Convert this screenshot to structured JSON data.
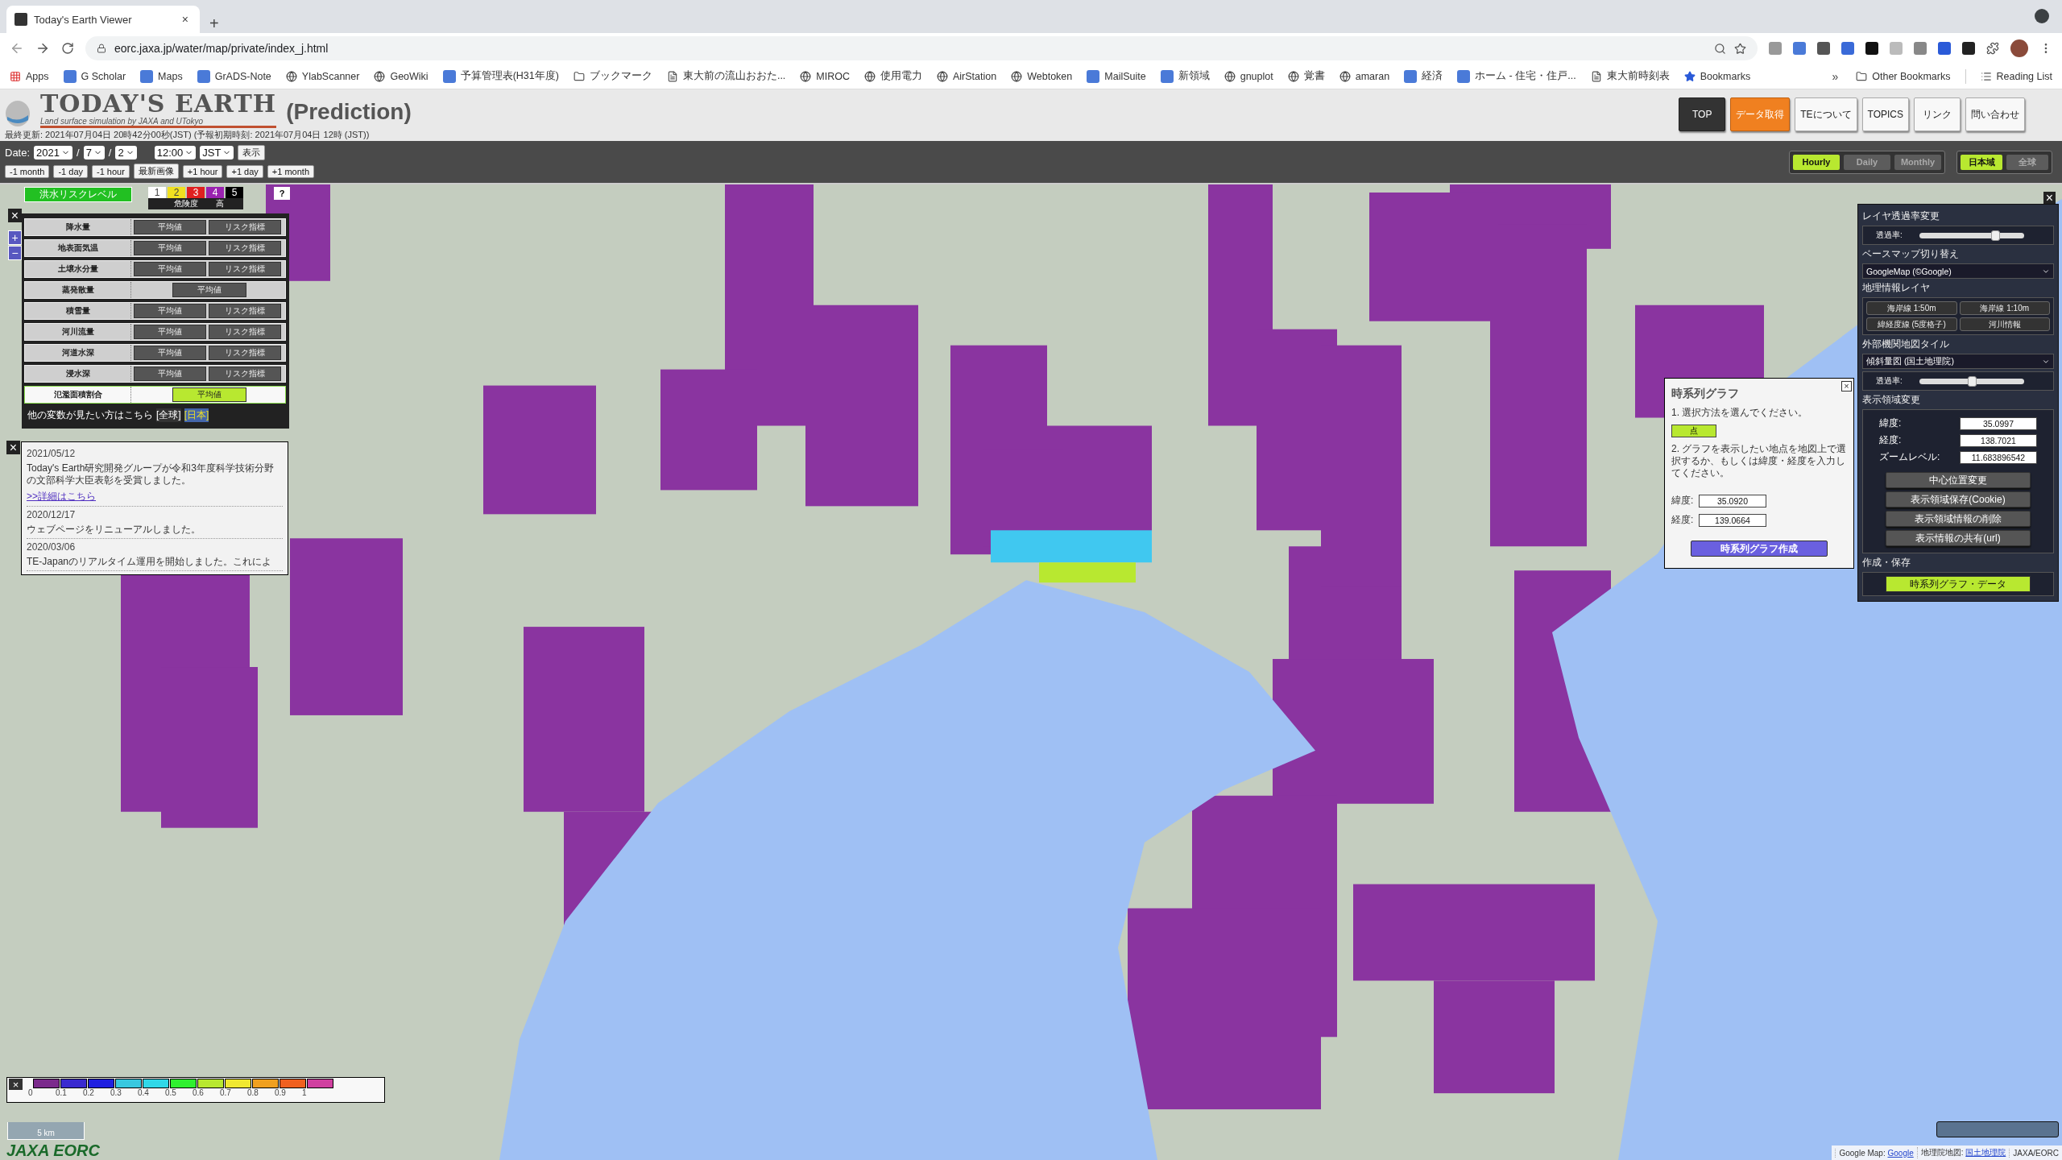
{
  "browser": {
    "tab_title": "Today's Earth Viewer",
    "tab_close": "×",
    "new_tab": "+",
    "url": "eorc.jaxa.jp/water/map/private/index_j.html",
    "bookmarks": [
      {
        "label": "Apps",
        "kind": "apps"
      },
      {
        "label": "G Scholar",
        "kind": "site"
      },
      {
        "label": "Maps",
        "kind": "site"
      },
      {
        "label": "GrADS-Note",
        "kind": "site"
      },
      {
        "label": "YlabScanner",
        "kind": "globe"
      },
      {
        "label": "GeoWiki",
        "kind": "globe"
      },
      {
        "label": "予算管理表(H31年度)",
        "kind": "site"
      },
      {
        "label": "ブックマーク",
        "kind": "folder"
      },
      {
        "label": "東大前の流山おおた...",
        "kind": "page"
      },
      {
        "label": "MIROC",
        "kind": "globe"
      },
      {
        "label": "使用電力",
        "kind": "globe"
      },
      {
        "label": "AirStation",
        "kind": "globe"
      },
      {
        "label": "Webtoken",
        "kind": "globe"
      },
      {
        "label": "MailSuite",
        "kind": "site"
      },
      {
        "label": "新領域",
        "kind": "site"
      },
      {
        "label": "gnuplot",
        "kind": "globe"
      },
      {
        "label": "覚書",
        "kind": "globe"
      },
      {
        "label": "amaran",
        "kind": "globe"
      },
      {
        "label": "経済",
        "kind": "site"
      },
      {
        "label": "ホーム - 住宅・住戸...",
        "kind": "site"
      },
      {
        "label": "東大前時刻表",
        "kind": "page"
      },
      {
        "label": "Bookmarks",
        "kind": "star"
      }
    ],
    "overflow": "»",
    "other_bookmarks": "Other Bookmarks",
    "reading_list": "Reading List"
  },
  "header": {
    "logo": "TODAY'S EARTH",
    "logo_tagline": "Land surface simulation by JAXA and UTokyo",
    "subtitle": "(Prediction)",
    "info": "最終更新: 2021年07月04日 20時42分00秒(JST) (予報初期時刻: 2021年07月04日 12時 (JST))",
    "nav": [
      {
        "label": "TOP",
        "kind": "dark"
      },
      {
        "label": "データ取得",
        "kind": "orange"
      },
      {
        "label": "TEについて",
        "kind": "light"
      },
      {
        "label": "TOPICS",
        "kind": "light"
      },
      {
        "label": "リンク",
        "kind": "light"
      },
      {
        "label": "問い合わせ",
        "kind": "light"
      }
    ]
  },
  "toolbar": {
    "date_label": "Date:",
    "year": "2021",
    "month": "7",
    "day": "2",
    "separator": "/",
    "time": "12:00",
    "zone": "JST",
    "show": "表示",
    "steps": [
      "-1 month",
      "-1 day",
      "-1 hour",
      "最新画像",
      "+1 hour",
      "+1 day",
      "+1 month"
    ],
    "intervals": [
      {
        "label": "Hourly",
        "selected": true
      },
      {
        "label": "Daily",
        "selected": false
      },
      {
        "label": "Monthly",
        "selected": false
      }
    ],
    "regions": [
      {
        "label": "日本域",
        "selected": true
      },
      {
        "label": "全球",
        "selected": false
      }
    ]
  },
  "risk_panel": {
    "close": "×",
    "zoom_in": "+",
    "zoom_out": "−",
    "title": "洪水リスクレベル",
    "help": "?",
    "danger_label": "危険度",
    "high_label": "高",
    "levels": [
      {
        "label": "1",
        "color": "#ffffff"
      },
      {
        "label": "2",
        "color": "#f0e020"
      },
      {
        "label": "3",
        "color": "#e02020"
      },
      {
        "label": "4",
        "color": "#9a22b0"
      },
      {
        "label": "5",
        "color": "#000000"
      }
    ],
    "rows": [
      {
        "label": "降水量",
        "selected": false,
        "buttons": [
          {
            "label": "平均値",
            "selected": false
          },
          {
            "label": "リスク指標",
            "selected": false
          }
        ]
      },
      {
        "label": "地表面気温",
        "selected": false,
        "buttons": [
          {
            "label": "平均値",
            "selected": false
          },
          {
            "label": "リスク指標",
            "selected": false
          }
        ]
      },
      {
        "label": "土壌水分量",
        "selected": false,
        "buttons": [
          {
            "label": "平均値",
            "selected": false
          },
          {
            "label": "リスク指標",
            "selected": false
          }
        ]
      },
      {
        "label": "蒸発散量",
        "selected": false,
        "buttons": [
          {
            "label": "平均値",
            "selected": false
          }
        ]
      },
      {
        "label": "積雪量",
        "selected": false,
        "buttons": [
          {
            "label": "平均値",
            "selected": false
          },
          {
            "label": "リスク指標",
            "selected": false
          }
        ]
      },
      {
        "label": "河川流量",
        "selected": false,
        "buttons": [
          {
            "label": "平均値",
            "selected": false
          },
          {
            "label": "リスク指標",
            "selected": false
          }
        ]
      },
      {
        "label": "河道水深",
        "selected": false,
        "buttons": [
          {
            "label": "平均値",
            "selected": false
          },
          {
            "label": "リスク指標",
            "selected": false
          }
        ]
      },
      {
        "label": "浸水深",
        "selected": false,
        "buttons": [
          {
            "label": "平均値",
            "selected": false
          },
          {
            "label": "リスク指標",
            "selected": false
          }
        ]
      },
      {
        "label": "氾濫面積割合",
        "selected": true,
        "buttons": [
          {
            "label": "平均値",
            "selected": true
          }
        ]
      }
    ],
    "more_text": "他の変数が見たい方はこちら",
    "more_links": [
      {
        "label": "[全球]",
        "selected": false
      },
      {
        "label": "[日本]",
        "selected": true
      }
    ]
  },
  "news": {
    "close": "×",
    "items": [
      {
        "date": "2021/05/12",
        "text": "Today's Earth研究開発グループが令和3年度科学技術分野の文部科学大臣表彰を受賞しました。",
        "link": ">>詳細はこちら"
      },
      {
        "date": "2020/12/17",
        "text": "ウェブページをリニューアルしました。"
      },
      {
        "date": "2020/03/06",
        "text": "TE-Japanのリアルタイム運用を開始しました。これによ"
      }
    ]
  },
  "timeseries_dialog": {
    "title": "時系列グラフ",
    "close": "×",
    "step1": "1. 選択方法を選んでください。",
    "methods": [
      {
        "label": "点",
        "selected": true
      }
    ],
    "step2": "2. グラフを表示したい地点を地図上で選択するか、もしくは緯度・経度を入力してください。",
    "fields": [
      {
        "label": "緯度:",
        "value": "35.0920"
      },
      {
        "label": "経度:",
        "value": "139.0664"
      }
    ],
    "submit": "時系列グラフ作成"
  },
  "settings_panel": {
    "close": "×",
    "opacity_title": "レイヤ透過率変更",
    "opacity_slider": {
      "label": "透過率:",
      "level": 0.72
    },
    "basemap_title": "ベースマップ切り替え",
    "basemap": "GoogleMap (©Google)",
    "geo_title": "地理情報レイヤ",
    "geo_layers": [
      "海岸線 1:50m",
      "海岸線 1:10m",
      "緯経度線 (5度格子)",
      "河川情報"
    ],
    "tile_title": "外部機関地図タイル",
    "tile": "傾斜量図 (国土地理院)",
    "tile_slider": {
      "label": "透過率:",
      "level": 0.5
    },
    "view_title": "表示領域変更",
    "view_fields": [
      {
        "label": "緯度:",
        "value": "35.0997"
      },
      {
        "label": "経度:",
        "value": "138.7021"
      },
      {
        "label": "ズームレベル:",
        "value": "11.683896542"
      }
    ],
    "view_buttons": [
      "中心位置変更",
      "表示領域保存(Cookie)",
      "表示領域情報の削除",
      "表示情報の共有(url)"
    ],
    "save_title": "作成・保存",
    "save_button": "時系列グラフ・データ"
  },
  "legend": {
    "close": "×",
    "bins": [
      {
        "tick": "0",
        "color": "#7b2a8c"
      },
      {
        "tick": "0.1",
        "color": "#3a2ad0"
      },
      {
        "tick": "0.2",
        "color": "#2020e0"
      },
      {
        "tick": "0.3",
        "color": "#38c8e0"
      },
      {
        "tick": "0.4",
        "color": "#30d8e8"
      },
      {
        "tick": "0.5",
        "color": "#30f030"
      },
      {
        "tick": "0.6",
        "color": "#b8e830"
      },
      {
        "tick": "0.7",
        "color": "#f0e830"
      },
      {
        "tick": "0.8",
        "color": "#f0a020"
      },
      {
        "tick": "0.9",
        "color": "#f06020"
      },
      {
        "tick": "1",
        "color": "#d040a0"
      }
    ]
  },
  "scale": "5 km",
  "brand": "JAXA EORC",
  "attribution": [
    {
      "prefix": "Google Map: ",
      "link": "Google"
    },
    {
      "prefix": "地理院地図: ",
      "link": "国土地理院"
    },
    {
      "prefix": "JAXA/EORC"
    }
  ]
}
